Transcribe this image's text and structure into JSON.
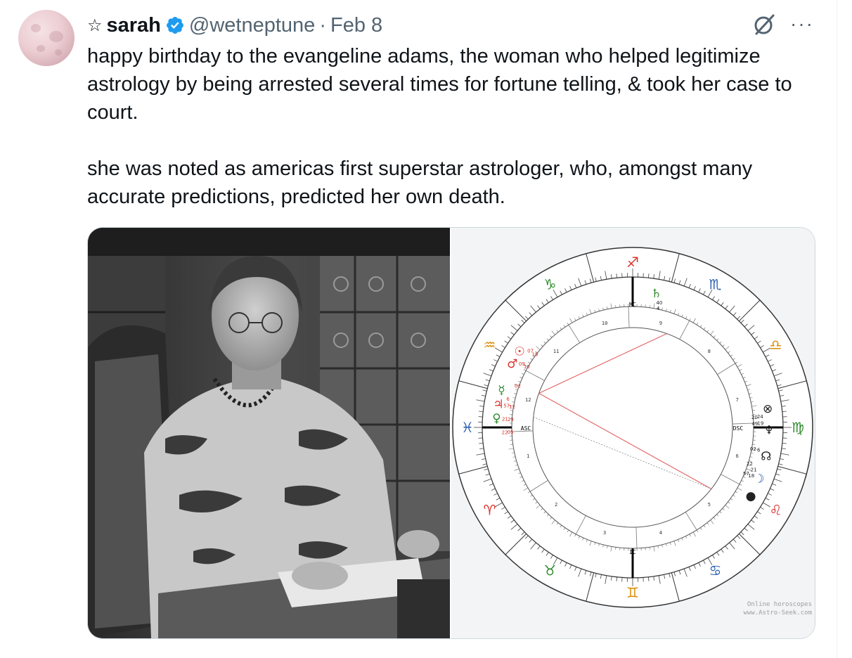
{
  "tweet": {
    "display_name": "sarah",
    "handle": "@wetneptune",
    "separator": "·",
    "date": "Feb 8",
    "paragraphs": [
      "happy birthday to the evangeline adams, the woman who helped legitimize astrology by being arrested several times for fortune telling, & took her case to court.",
      "she was noted as americas first superstar astrologer, who, amongst many accurate predictions, predicted her own death."
    ],
    "icons": {
      "name_prefix": "star-outline-icon",
      "verified": "verified-badge-icon",
      "grok": "grok-icon",
      "more": "more-options-icon"
    }
  },
  "media": {
    "photo": {
      "subject": "black and white portrait photo"
    },
    "chart": {
      "watermark_lines": [
        "Online horoscopes",
        "www.Astro-Seek.com"
      ],
      "angle_labels": [
        "MC",
        "IC",
        "ASC",
        "DSC"
      ],
      "house_numbers": [
        "1",
        "2",
        "3",
        "4",
        "5",
        "6",
        "7",
        "8",
        "9",
        "10",
        "11",
        "12"
      ],
      "degree_labels": [
        "10",
        "09",
        "19",
        "07",
        "02",
        "6",
        "12",
        "57",
        "29",
        "21",
        "05",
        "22",
        "4",
        "40",
        "20",
        "24",
        "49",
        "19",
        "02",
        "6",
        "22",
        "21",
        "57",
        "18"
      ]
    }
  },
  "colors": {
    "text_primary": "#0f1419",
    "text_secondary": "#536471",
    "verified_blue": "#1d9bf0",
    "border": "#cfd9de"
  }
}
